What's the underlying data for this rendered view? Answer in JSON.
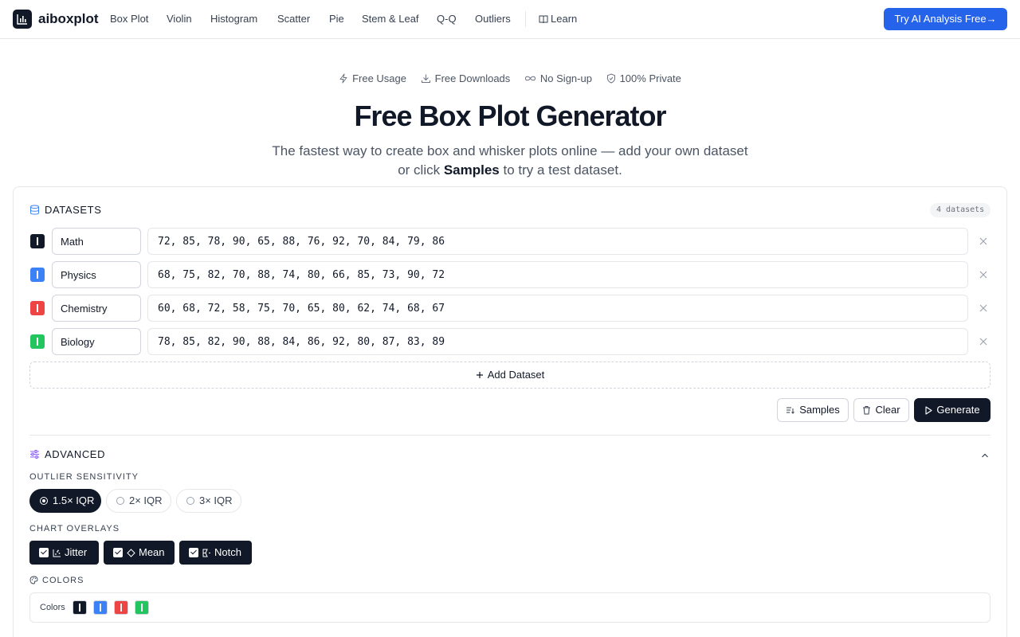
{
  "nav": {
    "brand": "aiboxplot",
    "items": [
      "Box Plot",
      "Violin",
      "Histogram",
      "Scatter",
      "Pie",
      "Stem & Leaf",
      "Q-Q",
      "Outliers"
    ],
    "learn": "Learn",
    "cta": "Try AI Analysis Free",
    "cta_color": "#2563eb"
  },
  "hero": {
    "badges": [
      "Free Usage",
      "Free Downloads",
      "No Sign-up",
      "100% Private"
    ],
    "title": "Free Box Plot Generator",
    "subtitle_pre": "The fastest way to create box and whisker plots online — add your own dataset or click ",
    "subtitle_bold": "Samples",
    "subtitle_post": " to try a test dataset."
  },
  "datasets": {
    "heading": "DATASETS",
    "count": "4 datasets",
    "rows": [
      {
        "name": "Math",
        "values": "72, 85, 78, 90, 65, 88, 76, 92, 70, 84, 79, 86",
        "color": "#111827"
      },
      {
        "name": "Physics",
        "values": "68, 75, 82, 70, 88, 74, 80, 66, 85, 73, 90, 72",
        "color": "#3b82f6"
      },
      {
        "name": "Chemistry",
        "values": "60, 68, 72, 58, 75, 70, 65, 80, 62, 74, 68, 67",
        "color": "#ef4444"
      },
      {
        "name": "Biology",
        "values": "78, 85, 82, 90, 88, 84, 86, 92, 80, 87, 83, 89",
        "color": "#22c55e"
      }
    ],
    "add_label": "Add Dataset",
    "samples_label": "Samples",
    "clear_label": "Clear",
    "generate_label": "Generate"
  },
  "advanced": {
    "heading": "ADVANCED",
    "outlier_label": "OUTLIER SENSITIVITY",
    "outlier_options": [
      "1.5× IQR",
      "2× IQR",
      "3× IQR"
    ],
    "outlier_selected": "1.5× IQR",
    "overlays_label": "CHART OVERLAYS",
    "overlays": [
      {
        "label": "Jitter",
        "checked": true
      },
      {
        "label": "Mean",
        "checked": true
      },
      {
        "label": "Notch",
        "checked": true
      }
    ],
    "colors_label": "COLORS",
    "colors_inner_label": "Colors",
    "colors": [
      "#111827",
      "#3b82f6",
      "#ef4444",
      "#22c55e"
    ]
  }
}
